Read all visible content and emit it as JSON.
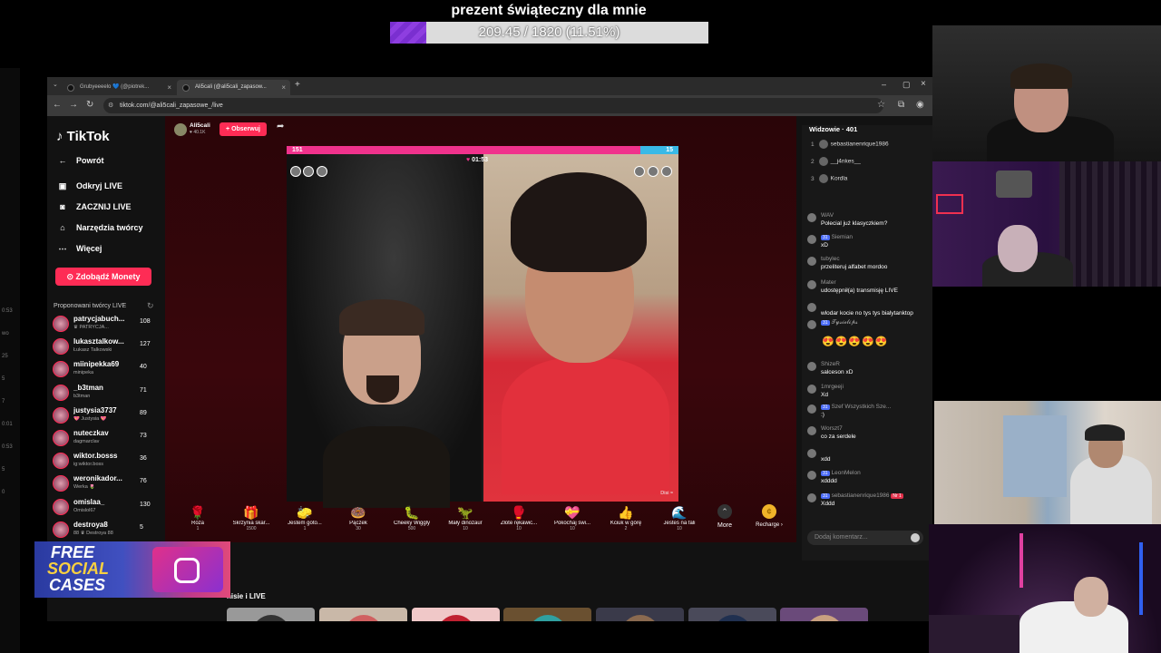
{
  "goal": {
    "title": "prezent świąteczny dla mnie",
    "progress_text": "209.45 / 1820 (11.51%)",
    "progress_fraction": 0.1151
  },
  "left_strip": [
    "0:53",
    "wo",
    "25",
    "5",
    "7",
    "0:01",
    "0:53",
    "5",
    "0"
  ],
  "browser": {
    "tabs": [
      {
        "label": "Grubyeeeelo 💙 (@piotrek...",
        "active": false
      },
      {
        "label": "Ali5cali (@ali5cali_zapasow...",
        "active": true
      }
    ],
    "url": "tiktok.com/@ali5cali_zapasowe_/live"
  },
  "sidebar": {
    "logo": "TikTok",
    "items": [
      {
        "label": "Powrót",
        "icon": "back-arrow-icon"
      },
      {
        "label": "Odkryj LIVE",
        "icon": "live-tv-icon"
      },
      {
        "label": "ZACZNIJ LIVE",
        "icon": "camera-icon"
      },
      {
        "label": "Narzędzia twórcy",
        "icon": "home-icon"
      },
      {
        "label": "Więcej",
        "icon": "more-dots-icon"
      }
    ],
    "coins_button": "Zdobądź Monety",
    "suggested_title": "Proponowani twórcy LIVE",
    "creators": [
      {
        "name": "patrycjabuch...",
        "sub": "♛ PATRYCJA...",
        "count": "108"
      },
      {
        "name": "lukasztalkow...",
        "sub": "Łukasz Talkowski",
        "count": "127"
      },
      {
        "name": "miinipekka69",
        "sub": "minipeka",
        "count": "40"
      },
      {
        "name": "_b3tman",
        "sub": "b3tman",
        "count": "71"
      },
      {
        "name": "justysia3737",
        "sub": "💖 Justysia 💖",
        "count": "89"
      },
      {
        "name": "nuteczkav",
        "sub": "dagmarclav",
        "count": "73"
      },
      {
        "name": "wiktor.bosss",
        "sub": "ig:wiktor.boss",
        "count": "36"
      },
      {
        "name": "weronikador...",
        "sub": "Werka 🌷",
        "count": "76"
      },
      {
        "name": "omislaa_",
        "sub": "Omislol67",
        "count": "130"
      },
      {
        "name": "destroya8",
        "sub": "88 ♛ Destroya 88",
        "count": "5"
      }
    ]
  },
  "stream": {
    "host_name": "Ali5cali",
    "host_likes": "♥ 40.1K",
    "follow_label": "+ Obserwuj",
    "score_left": "151",
    "score_right": "15",
    "timer": "01:53",
    "right_cam_label": "Disi ≈",
    "gifts": [
      {
        "name": "Róża",
        "price": "1",
        "icon": "🌹"
      },
      {
        "name": "Skrzynia skar...",
        "price": "1500",
        "icon": "🎁"
      },
      {
        "name": "Jestem goto...",
        "price": "1",
        "icon": "🧽"
      },
      {
        "name": "Pączek",
        "price": "30",
        "icon": "🍩"
      },
      {
        "name": "Cheeky Wiggly",
        "price": "500",
        "icon": "🐛"
      },
      {
        "name": "Mały dinozaur",
        "price": "10",
        "icon": "🦖"
      },
      {
        "name": "Złote rękawic...",
        "price": "10",
        "icon": "🥊"
      },
      {
        "name": "Pokochaj świ...",
        "price": "10",
        "icon": "💝"
      },
      {
        "name": "Kciuk w górę",
        "price": "2",
        "icon": "👍"
      },
      {
        "name": "Jesteś na fali",
        "price": "10",
        "icon": "🌊"
      }
    ],
    "more_label": "More",
    "recharge_label": "Recharge ›"
  },
  "chat": {
    "viewers_title": "Widzowie · 401",
    "top_viewers": [
      {
        "rank": "1",
        "name": "sebastianenrique1986"
      },
      {
        "rank": "2",
        "name": "__j4nkes__"
      },
      {
        "rank": "3",
        "name": "Kordla"
      }
    ],
    "messages": [
      {
        "user": "WAV",
        "text": "Polecial już klasyczkiem?",
        "badge": ""
      },
      {
        "user": "Siemian",
        "text": "xD",
        "badge": "31"
      },
      {
        "user": "tubylec",
        "text": "przeliteruj alfabet mordoo",
        "badge": ""
      },
      {
        "user": "Mater",
        "text": "udostępnił(a) transmisję LIVE",
        "badge": ""
      },
      {
        "user": "",
        "text": "wlodar kocie no tys tys bialytanktop",
        "badge": ""
      },
      {
        "user": "𝓣𝔂𝓼𝓲𝓮𝓵𝓲𝓹𝓼",
        "text": "",
        "badge": "31"
      },
      {
        "user": "ShizeR",
        "text": "salceson xD",
        "badge": ""
      },
      {
        "user": "1mrgeeji",
        "text": "Xd",
        "badge": ""
      },
      {
        "user": "Szef Wszystkich Sze...",
        "text": ":)",
        "badge": "31"
      },
      {
        "user": "Worszt7",
        "text": "co za serdele",
        "badge": ""
      },
      {
        "user": "",
        "text": "xdd",
        "badge": ""
      },
      {
        "user": "LeonMelon",
        "text": "xdddd",
        "badge": "31"
      },
      {
        "user": "sebastianenrique1986",
        "text": "Xddd",
        "badge": "31",
        "extra_badge": "Nr 1"
      }
    ],
    "comment_placeholder": "Dodaj komentarz..."
  },
  "more_live_label": "nisie i LIVE",
  "ad": {
    "line1": "FREE",
    "line2": "SOCIAL",
    "line3": "CASES"
  },
  "colors": {
    "tiktok_red": "#fe2c55",
    "score_pink": "#f0328c",
    "score_blue": "#39b9e6",
    "goal_purple": "#7a2fd0"
  }
}
